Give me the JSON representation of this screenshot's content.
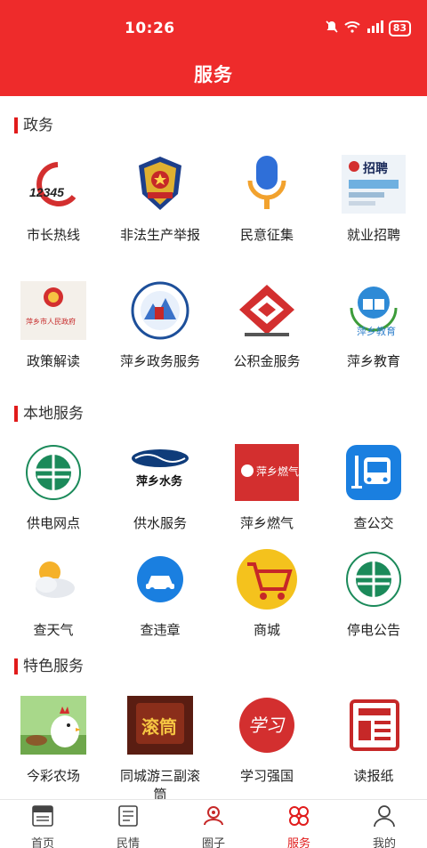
{
  "status_bar": {
    "time": "10:26",
    "battery": "83"
  },
  "header": {
    "title": "服务"
  },
  "sections": [
    {
      "title": "政务",
      "items": [
        {
          "label": "市长热线",
          "icon": "phone-12345-icon",
          "icon_text": "12345"
        },
        {
          "label": "非法生产举报",
          "icon": "police-badge-icon"
        },
        {
          "label": "民意征集",
          "icon": "microphone-icon"
        },
        {
          "label": "就业招聘",
          "icon": "recruitment-icon",
          "icon_text": "招聘"
        },
        {
          "label": "政策解读",
          "icon": "government-emblem-icon",
          "icon_text": "萍乡市人民政府"
        },
        {
          "label": "萍乡政务服务",
          "icon": "gov-service-logo-icon"
        },
        {
          "label": "公积金服务",
          "icon": "housing-fund-logo-icon"
        },
        {
          "label": "萍乡教育",
          "icon": "education-logo-icon",
          "icon_text": "萍乡教育"
        }
      ]
    },
    {
      "title": "本地服务",
      "items": [
        {
          "label": "供电网点",
          "icon": "state-grid-logo-icon"
        },
        {
          "label": "供水服务",
          "icon": "water-logo-icon",
          "icon_text": "萍乡水务"
        },
        {
          "label": "萍乡燃气",
          "icon": "gas-logo-icon",
          "icon_text": "萍乡燃气"
        },
        {
          "label": "查公交",
          "icon": "bus-icon"
        },
        {
          "label": "查天气",
          "icon": "weather-icon"
        },
        {
          "label": "查违章",
          "icon": "car-icon"
        },
        {
          "label": "商城",
          "icon": "shopping-cart-icon"
        },
        {
          "label": "停电公告",
          "icon": "state-grid-logo-icon"
        }
      ]
    },
    {
      "title": "特色服务",
      "items": [
        {
          "label": "今彩农场",
          "icon": "farm-chicken-icon"
        },
        {
          "label": "同城游三副滚筒",
          "icon": "game-poster-icon",
          "icon_text": "滚筒"
        },
        {
          "label": "学习强国",
          "icon": "xuexi-logo-icon",
          "icon_text": "学习"
        },
        {
          "label": "读报纸",
          "icon": "newspaper-icon"
        }
      ]
    }
  ],
  "tabbar": [
    {
      "label": "首页",
      "icon": "news-icon",
      "active": false
    },
    {
      "label": "民情",
      "icon": "document-icon",
      "active": false
    },
    {
      "label": "圈子",
      "icon": "location-person-icon",
      "active": false
    },
    {
      "label": "服务",
      "icon": "grid-service-icon",
      "active": true
    },
    {
      "label": "我的",
      "icon": "user-icon",
      "active": false
    }
  ],
  "colors": {
    "primary_red": "#ee2b2b",
    "accent_red": "#e11b1b",
    "blue": "#1a7fe0",
    "green": "#1b8a5a"
  }
}
